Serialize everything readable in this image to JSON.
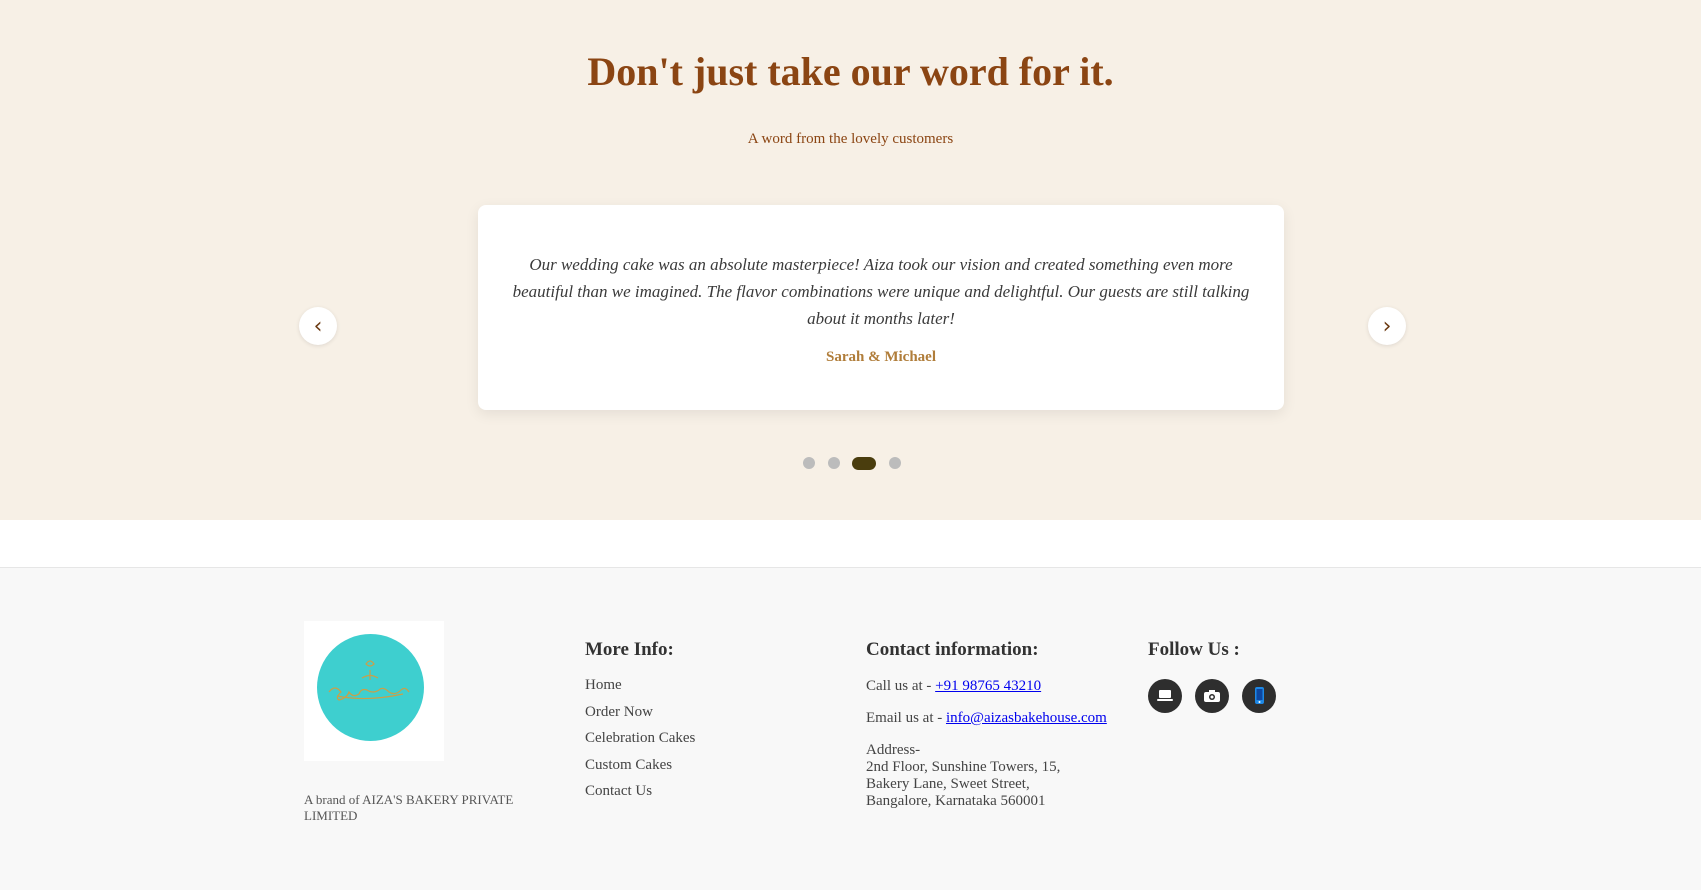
{
  "testimonials": {
    "title": "Don't just take our word for it.",
    "subtitle": "A word from the lovely customers",
    "prev_label": "‹",
    "next_label": "›",
    "quote": "Our wedding cake was an absolute masterpiece! Aiza took our vision and created something even more beautiful than we imagined. The flavor combinations were unique and delightful. Our guests are still talking about it months later!",
    "author": "Sarah & Michael",
    "slide_count": 4,
    "active_slide": 3
  },
  "footer": {
    "logo_alt": "Aiza's Bakehouse",
    "brand": "A brand of AIZA'S BAKERY PRIVATE LIMITED",
    "more_info": {
      "heading": "More Info:",
      "links": [
        "Home",
        "Order Now",
        "Celebration Cakes",
        "Custom Cakes",
        "Contact Us"
      ]
    },
    "contact": {
      "heading": "Contact information:",
      "call_prefix": "Call us at - ",
      "phone": "+91 98765 43210",
      "email_prefix": "Email us at - ",
      "email": "info@aizasbakehouse.com",
      "address_label": "Address-",
      "address_line1": "2nd Floor, Sunshine Towers, 15,",
      "address_line2": "Bakery Lane, Sweet Street,",
      "address_line3": "Bangalore, Karnataka 560001"
    },
    "follow": {
      "heading": "Follow Us :",
      "icons": [
        "laptop-icon",
        "camera-icon",
        "mobile-phone-icon"
      ]
    }
  },
  "colors": {
    "section_bg": "#f7f0e6",
    "heading_brown": "#8b4513",
    "author_gold": "#b07d3a",
    "active_dot": "#4a3d0e",
    "logo_teal": "#3ecfcf",
    "footer_bg": "#f8f8f8"
  }
}
